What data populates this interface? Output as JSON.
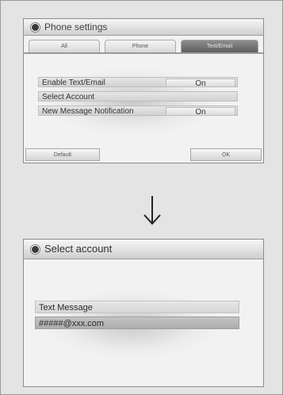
{
  "screen1": {
    "title": "Phone settings",
    "tabs": [
      "All",
      "Phone",
      "Text/Email"
    ],
    "active_tab": "Text/Email",
    "rows": [
      {
        "label": "Enable Text/Email",
        "value": "On"
      },
      {
        "label": "Select Account",
        "value": ""
      },
      {
        "label": "New Message Notification",
        "value": "On"
      }
    ],
    "buttons": {
      "default": "Default",
      "ok": "OK"
    }
  },
  "arrow": {
    "icon": "down-arrow-icon"
  },
  "screen2": {
    "title": "Select account",
    "items": [
      "Text Message",
      "#####@xxx.com"
    ],
    "selected": "#####@xxx.com"
  },
  "colors": {
    "active_tab": "#6e6e6e",
    "selected_row": "#b5b5b5"
  }
}
